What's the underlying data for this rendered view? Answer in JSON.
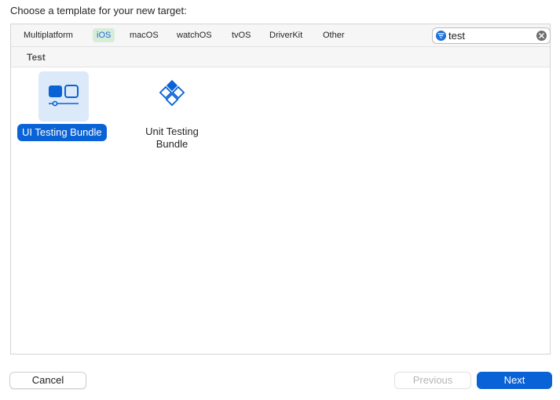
{
  "dialog": {
    "heading": "Choose a template for your new target:"
  },
  "tabs": [
    {
      "label": "Multiplatform",
      "selected": false
    },
    {
      "label": "iOS",
      "selected": true
    },
    {
      "label": "macOS",
      "selected": false
    },
    {
      "label": "watchOS",
      "selected": false
    },
    {
      "label": "tvOS",
      "selected": false
    },
    {
      "label": "DriverKit",
      "selected": false
    },
    {
      "label": "Other",
      "selected": false
    }
  ],
  "search": {
    "value": "test",
    "icon": "filter-icon",
    "clear_icon": "clear-icon"
  },
  "section": {
    "title": "Test"
  },
  "templates": [
    {
      "label": "UI Testing Bundle",
      "icon": "ui-testing-bundle-icon",
      "selected": true
    },
    {
      "label_line1": "Unit Testing",
      "label_line2": "Bundle",
      "icon": "unit-testing-bundle-icon",
      "selected": false
    }
  ],
  "buttons": {
    "cancel": "Cancel",
    "previous": "Previous",
    "next": "Next"
  },
  "colors": {
    "accent": "#0a63d6",
    "selected_tab_bg": "#d7ecd9",
    "selected_tile_bg": "#dce9f9"
  }
}
